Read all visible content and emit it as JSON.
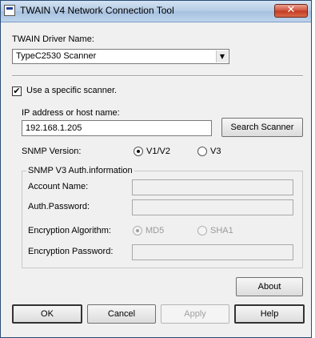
{
  "window": {
    "title": "TWAIN V4 Network Connection Tool",
    "close_glyph": "✕"
  },
  "driver": {
    "label": "TWAIN Driver Name:",
    "selected": "TypeC2530 Scanner",
    "arrow_glyph": "▼"
  },
  "specific_scanner": {
    "label": "Use a specific scanner.",
    "checked": true,
    "check_glyph": "✔"
  },
  "ip": {
    "label": "IP address or host name:",
    "value": "192.168.1.205"
  },
  "search_button": "Search Scanner",
  "snmp_version": {
    "label": "SNMP Version:",
    "options": [
      "V1/V2",
      "V3"
    ],
    "selected": "V1/V2"
  },
  "v3_auth": {
    "group_title": "SNMP V3 Auth.information",
    "account_label": "Account Name:",
    "account_value": "",
    "password_label": "Auth.Password:",
    "password_value": "",
    "algorithm_label": "Encryption Algorithm:",
    "algorithm_options": [
      "MD5",
      "SHA1"
    ],
    "algorithm_selected": "MD5",
    "enc_password_label": "Encryption Password:",
    "enc_password_value": ""
  },
  "buttons": {
    "about": "About",
    "ok": "OK",
    "cancel": "Cancel",
    "apply": "Apply",
    "help": "Help"
  }
}
